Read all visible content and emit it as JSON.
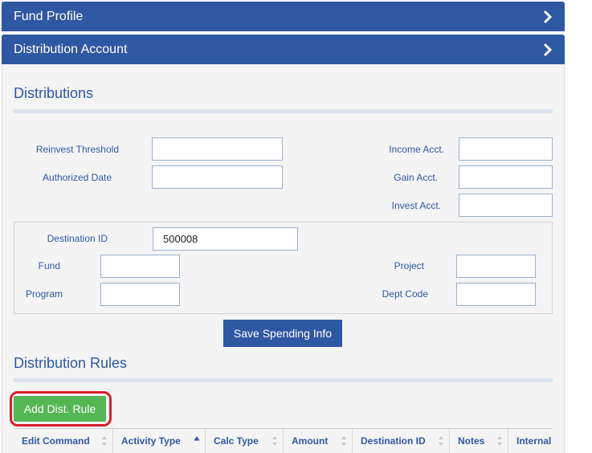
{
  "panels": {
    "fund_profile": {
      "title": "Fund Profile"
    },
    "distribution_account": {
      "title": "Distribution Account"
    }
  },
  "distributions": {
    "title": "Distributions",
    "fields": {
      "reinvest_threshold": {
        "label": "Reinvest Threshold",
        "value": ""
      },
      "authorized_date": {
        "label": "Authorized Date",
        "value": ""
      },
      "income_acct": {
        "label": "Income Acct.",
        "value": ""
      },
      "gain_acct": {
        "label": "Gain Acct.",
        "value": ""
      },
      "invest_acct": {
        "label": "Invest Acct.",
        "value": ""
      }
    },
    "destination": {
      "destination_id": {
        "label": "Destination ID",
        "value": "500008"
      },
      "fund": {
        "label": "Fund",
        "value": ""
      },
      "program": {
        "label": "Program",
        "value": ""
      },
      "project": {
        "label": "Project",
        "value": ""
      },
      "dept_code": {
        "label": "Dept Code",
        "value": ""
      }
    },
    "save_button": "Save Spending Info"
  },
  "rules": {
    "title": "Distribution Rules",
    "add_button": "Add Dist. Rule",
    "columns": [
      {
        "label": "Edit Command",
        "sort": "none"
      },
      {
        "label": "Activity Type",
        "sort": "ascending"
      },
      {
        "label": "Calc Type",
        "sort": "none"
      },
      {
        "label": "Amount",
        "sort": "none"
      },
      {
        "label": "Destination ID",
        "sort": "none"
      },
      {
        "label": "Notes",
        "sort": "none"
      },
      {
        "label": "Internal",
        "sort": "none"
      }
    ]
  },
  "colors": {
    "header_blue": "#2f58a3",
    "add_green": "#55b654",
    "highlight_red": "#d8202a"
  }
}
